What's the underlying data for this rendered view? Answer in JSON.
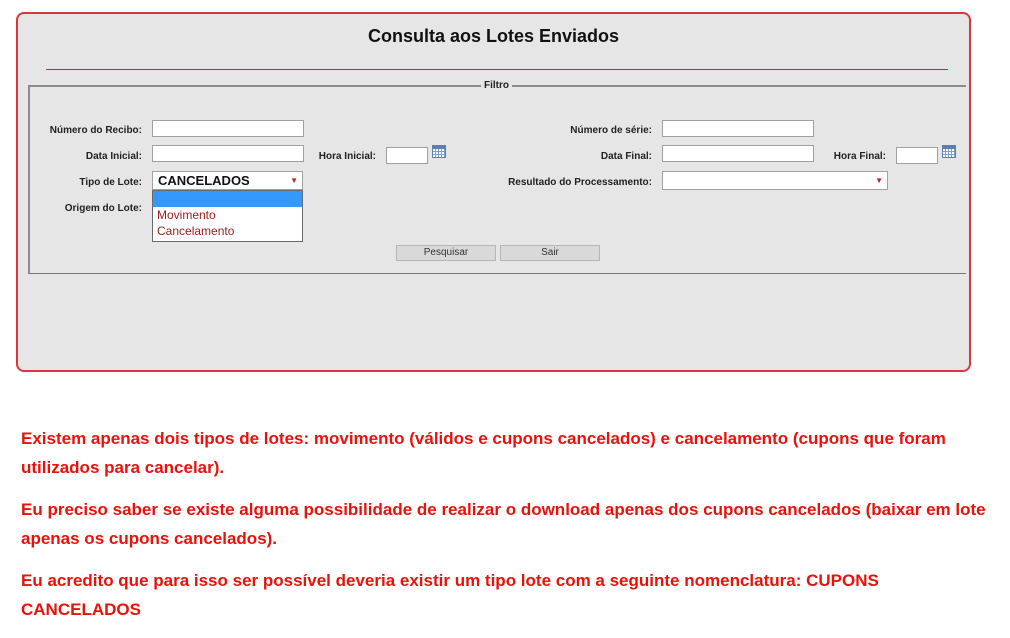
{
  "form": {
    "title": "Consulta aos Lotes Enviados",
    "legend": "Filtro",
    "labels": {
      "numero_recibo": "Número do Recibo:",
      "numero_serie": "Número de série:",
      "data_inicial": "Data Inicial:",
      "hora_inicial": "Hora Inicial:",
      "data_final": "Data Final:",
      "hora_final": "Hora Final:",
      "tipo_lote": "Tipo de Lote:",
      "resultado": "Resultado do Processamento:",
      "origem": "Origem do Lote:"
    },
    "tipo_lote": {
      "selected": "CANCELADOS",
      "options": [
        "",
        "Movimento",
        "Cancelamento"
      ]
    },
    "resultado_selected": "",
    "buttons": {
      "pesquisar": "Pesquisar",
      "sair": "Sair"
    }
  },
  "notes": [
    "Existem apenas dois tipos de lotes: movimento (válidos e cupons cancelados) e cancelamento (cupons que foram utilizados para cancelar).",
    "Eu preciso saber se existe alguma possibilidade de realizar o download apenas dos cupons cancelados (baixar em lote apenas os cupons cancelados).",
    "Eu acredito que para isso ser possível deveria existir um tipo lote com a seguinte nomenclatura: CUPONS CANCELADOS"
  ],
  "colors": {
    "panel_border": "#d9363e",
    "panel_bg": "#e6e6e6",
    "note_text": "#e8120c",
    "option_text": "#9a1c1c",
    "highlight": "#3399ff"
  },
  "icons": {
    "calendar": "calendar-icon",
    "dropdown": "chevron-down-icon"
  }
}
